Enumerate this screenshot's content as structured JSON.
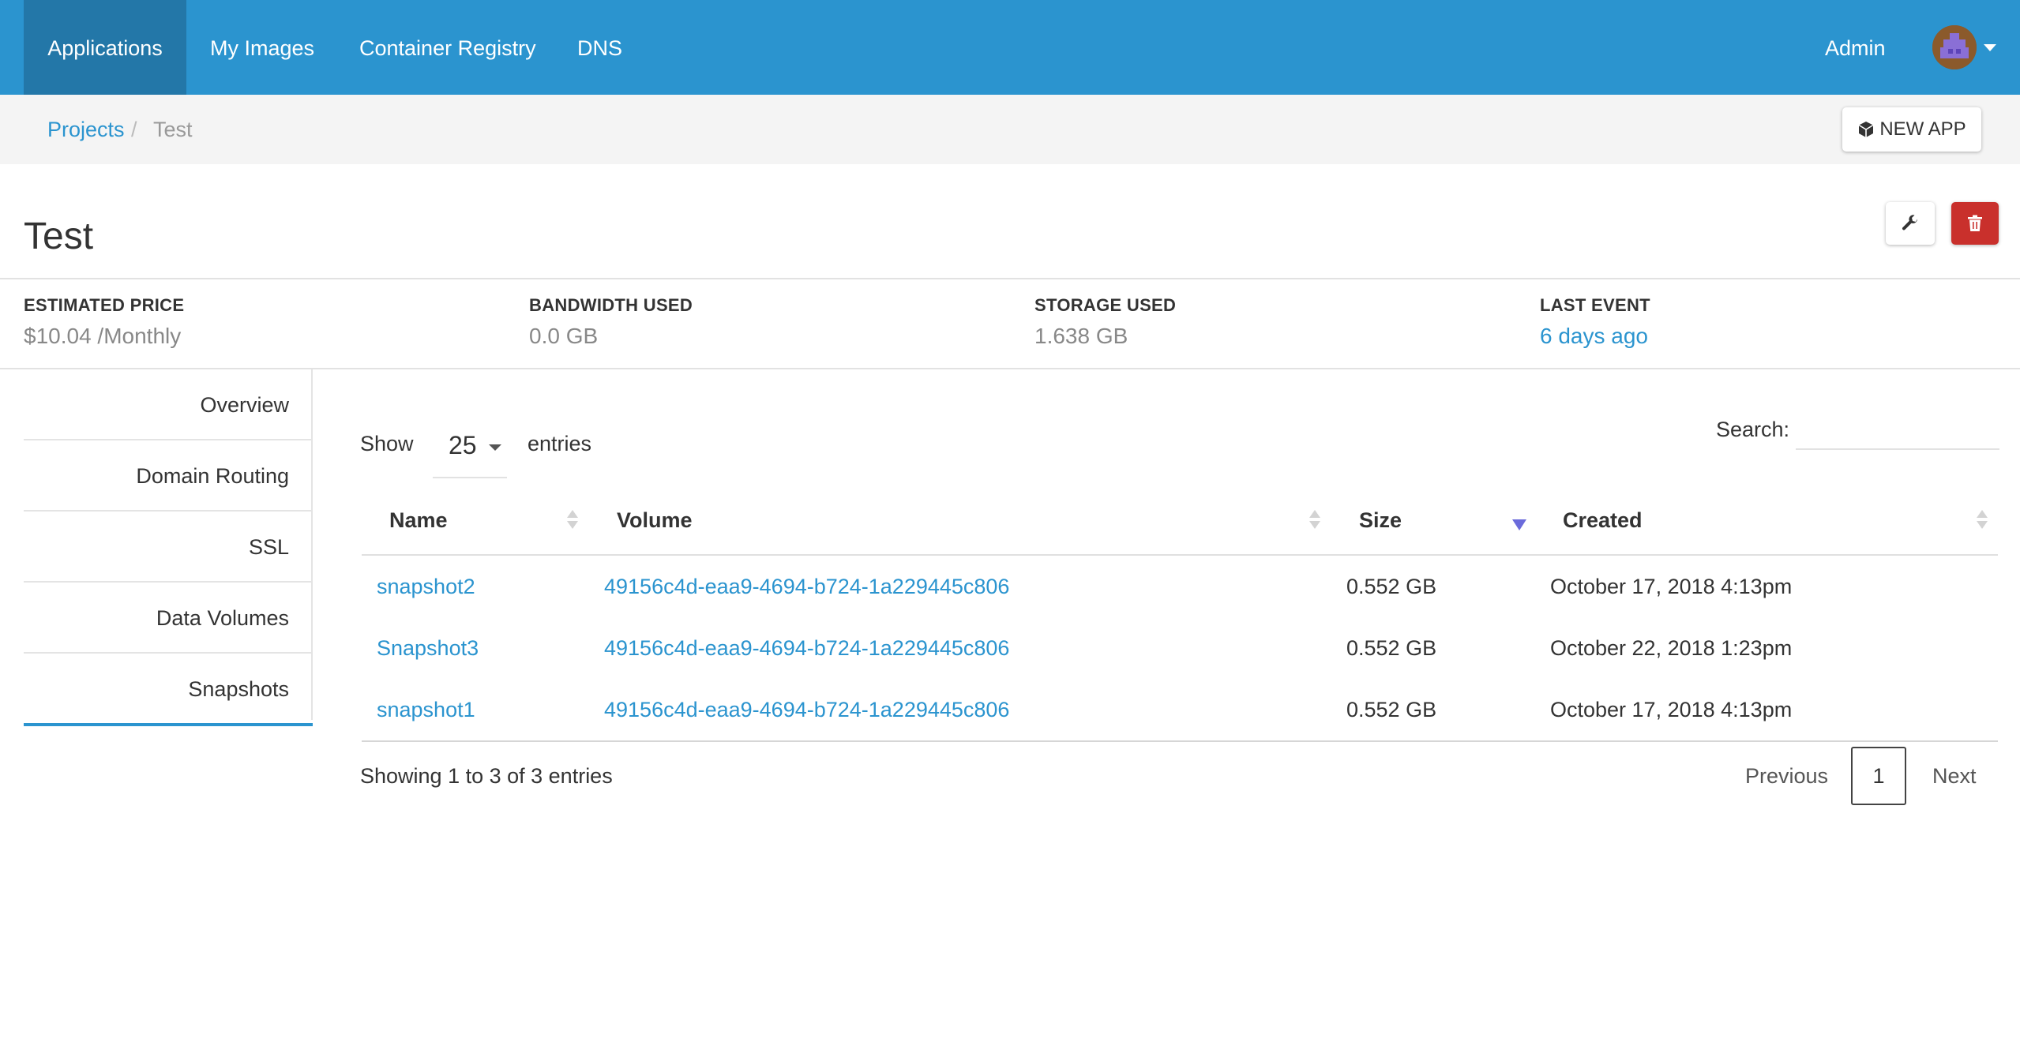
{
  "nav": {
    "items": [
      {
        "label": "Applications",
        "active": true
      },
      {
        "label": "My Images"
      },
      {
        "label": "Container Registry"
      },
      {
        "label": "DNS"
      }
    ],
    "user_label": "Admin",
    "accent_color": "#2b94cf",
    "active_color": "#2377a8"
  },
  "breadcrumb": {
    "items": [
      "Projects",
      "Test"
    ],
    "separator": "/"
  },
  "new_app_label": "NEW APP",
  "page_title": "Test",
  "stats": [
    {
      "label": "ESTIMATED PRICE",
      "value": "$10.04 /Monthly"
    },
    {
      "label": "BANDWIDTH USED",
      "value": "0.0 GB"
    },
    {
      "label": "STORAGE USED",
      "value": "1.638 GB"
    },
    {
      "label": "LAST EVENT",
      "value": "6 days ago"
    }
  ],
  "side_tabs": [
    {
      "label": "Overview"
    },
    {
      "label": "Domain Routing"
    },
    {
      "label": "SSL"
    },
    {
      "label": "Data Volumes"
    },
    {
      "label": "Snapshots",
      "active": true
    }
  ],
  "table_controls": {
    "show_label": "Show",
    "entries_label": "entries",
    "page_length": "25",
    "search_label": "Search:",
    "search_value": ""
  },
  "table": {
    "columns": [
      "Name",
      "Volume",
      "Size",
      "Created"
    ],
    "sorted_column": "Size",
    "rows": [
      {
        "name": "snapshot2",
        "volume": "49156c4d-eaa9-4694-b724-1a229445c806",
        "size": "0.552 GB",
        "created": "October 17, 2018 4:13pm"
      },
      {
        "name": "Snapshot3",
        "volume": "49156c4d-eaa9-4694-b724-1a229445c806",
        "size": "0.552 GB",
        "created": "October 22, 2018 1:23pm"
      },
      {
        "name": "snapshot1",
        "volume": "49156c4d-eaa9-4694-b724-1a229445c806",
        "size": "0.552 GB",
        "created": "October 17, 2018 4:13pm"
      }
    ]
  },
  "table_footer": {
    "info": "Showing 1 to 3 of 3 entries",
    "previous_label": "Previous",
    "current_page": "1",
    "next_label": "Next"
  },
  "icons": {
    "new_app": "cube-icon",
    "settings": "wrench-icon",
    "delete": "trash-icon",
    "user": "avatar-icon"
  },
  "danger_color": "#c9302c"
}
